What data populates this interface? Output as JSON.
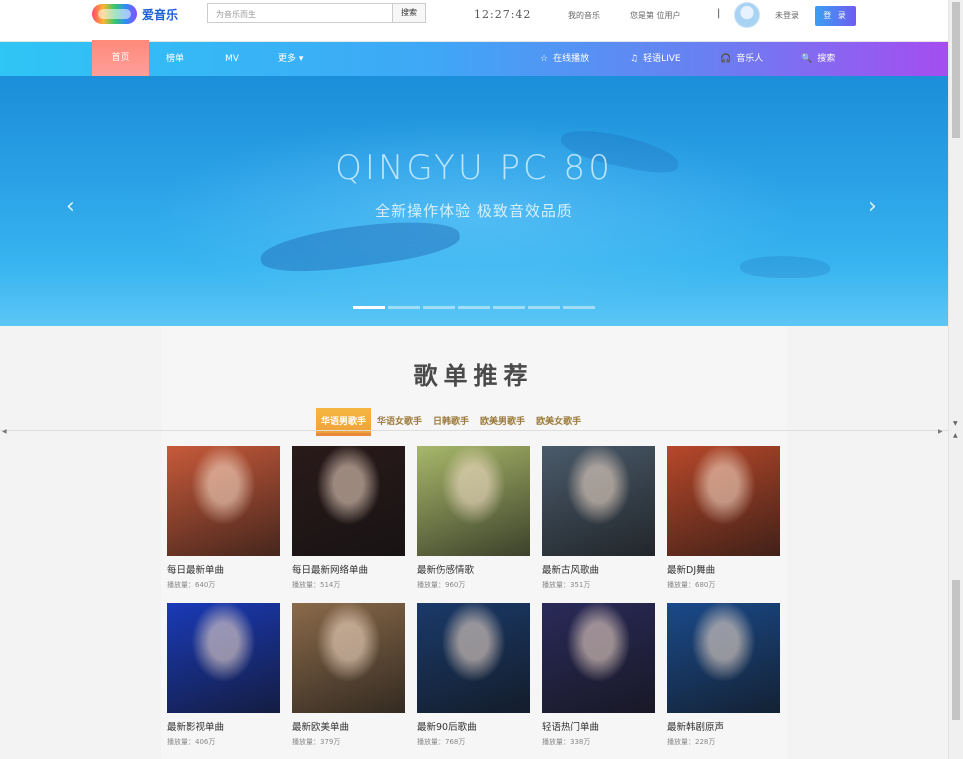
{
  "header": {
    "logo_text": "爱音乐",
    "search_placeholder": "为音乐而生",
    "search_button": "搜索",
    "clock": "12:27:42",
    "my_music": "我的音乐",
    "visitor_text": "您是第   位用户",
    "separator": "|",
    "not_logged_in": "未登录",
    "login_button": "登 录"
  },
  "nav": {
    "home": "首页",
    "charts": "榜单",
    "mv": "MV",
    "more": "更多 ▾",
    "online_play": "在线播放",
    "live": "轻语LIVE",
    "musician": "音乐人",
    "search": "搜索"
  },
  "banner": {
    "title": "QINGYU PC 80",
    "subtitle": "全新操作体验  极致音效品质",
    "prev_arrow": "‹",
    "next_arrow": "›",
    "slide_count": 7,
    "active_slide": 0
  },
  "section": {
    "title": "歌单推荐",
    "tabs": [
      "华语男歌手",
      "华语女歌手",
      "日韩歌手",
      "欧美男歌手",
      "欧美女歌手"
    ],
    "active_tab": 0
  },
  "playlists": [
    {
      "title": "每日最新单曲",
      "plays": "播放量：640万",
      "color": "#c85a3a"
    },
    {
      "title": "每日最新网络单曲",
      "plays": "播放量：514万",
      "color": "#2a1a1a"
    },
    {
      "title": "最新伤感情歌",
      "plays": "播放量：960万",
      "color": "#a8b86a"
    },
    {
      "title": "最新古风歌曲",
      "plays": "播放量：351万",
      "color": "#4a5a6a"
    },
    {
      "title": "最新DJ舞曲",
      "plays": "播放量：680万",
      "color": "#b8482a"
    },
    {
      "title": "最新影视单曲",
      "plays": "播放量：406万",
      "color": "#1a3ab8"
    },
    {
      "title": "最新欧美单曲",
      "plays": "播放量：379万",
      "color": "#8a6a4a"
    },
    {
      "title": "最新90后歌曲",
      "plays": "播放量：768万",
      "color": "#1a3a6a"
    },
    {
      "title": "轻语热门单曲",
      "plays": "播放量：338万",
      "color": "#2a2a5a"
    },
    {
      "title": "最新韩剧原声",
      "plays": "播放量：228万",
      "color": "#1a4a8a"
    }
  ]
}
